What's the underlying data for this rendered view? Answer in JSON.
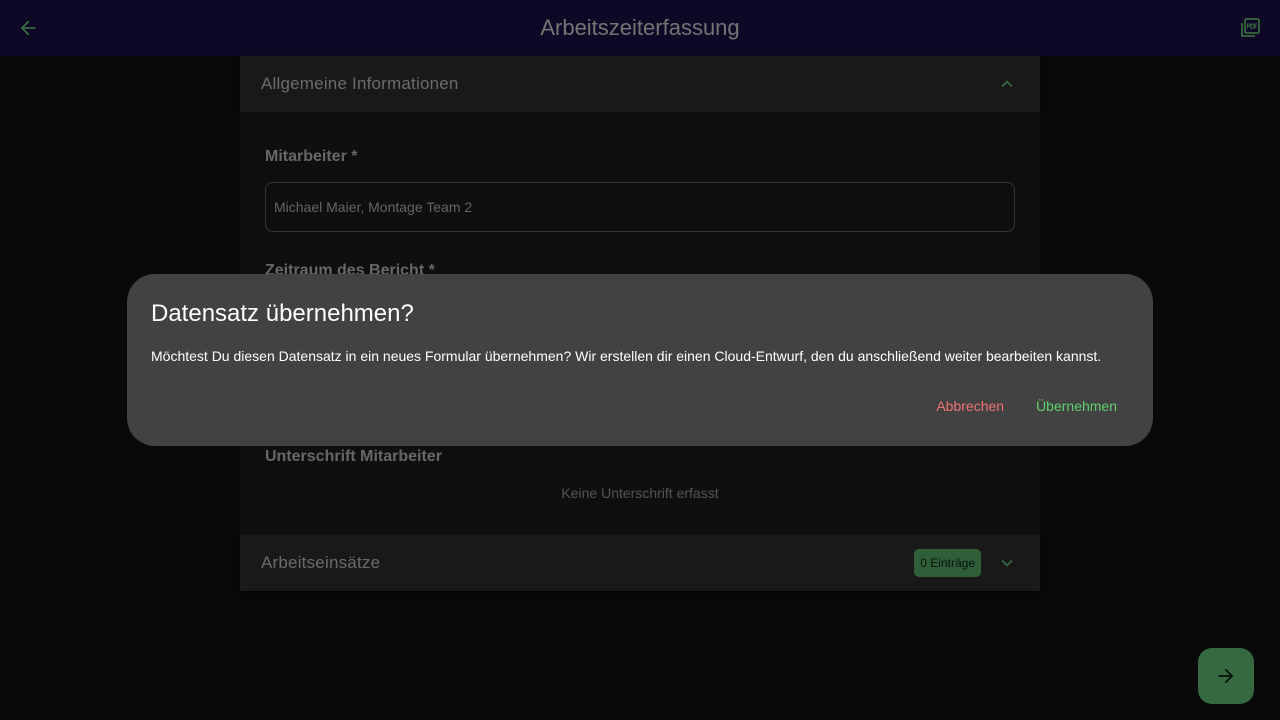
{
  "app": {
    "title": "Arbeitszeiterfassung"
  },
  "sections": {
    "general": {
      "header": "Allgemeine Informationen",
      "employee_label": "Mitarbeiter *",
      "employee_value": "Michael Maier, Montage Team 2",
      "period_label": "Zeitraum des Bericht *",
      "signature_label": "Unterschrift Mitarbeiter",
      "signature_empty": "Keine Unterschrift erfasst"
    },
    "assignments": {
      "header": "Arbeitseinsätze",
      "badge": "0 Einträge"
    }
  },
  "dialog": {
    "title": "Datensatz übernehmen?",
    "text": "Möchtest Du diesen Datensatz in ein neues Formular übernehmen? Wir erstellen dir einen Cloud-Entwurf, den du anschließend weiter bearbeiten kannst.",
    "cancel_label": "Abbrechen",
    "accept_label": "Übernehmen"
  },
  "icons": {
    "back": "arrow-back-icon",
    "pdf": "pdf-icon",
    "expand_less": "chevron-up-icon",
    "expand_more": "chevron-down-icon",
    "next": "arrow-forward-icon"
  },
  "colors": {
    "topbar": "#1d0f4a",
    "accent": "#6ed381",
    "cancel": "#f07272",
    "dialog": "#424242"
  }
}
